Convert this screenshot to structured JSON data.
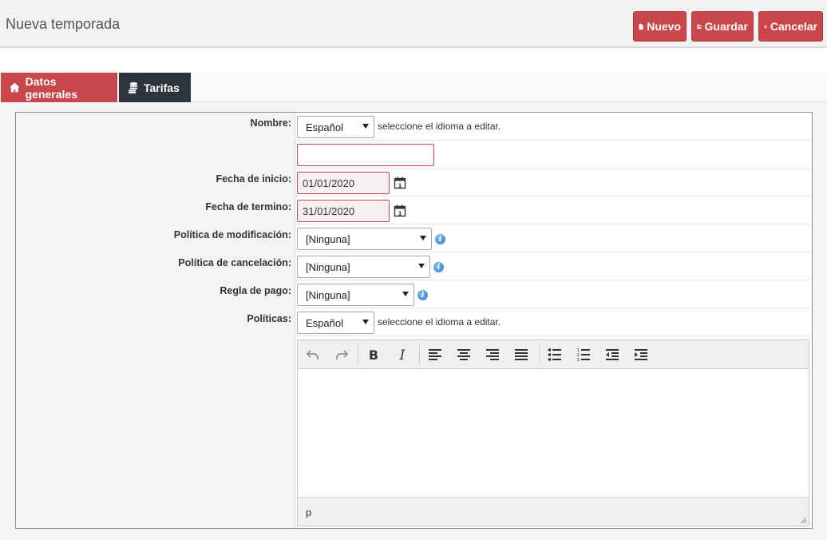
{
  "header": {
    "title": "Nueva temporada",
    "buttons": {
      "nuevo": "Nuevo",
      "guardar": "Guardar",
      "cancelar": "Cancelar"
    }
  },
  "tabs": [
    {
      "label": "Datos generales",
      "active": true
    },
    {
      "label": "Tarifas",
      "active": false
    }
  ],
  "form": {
    "nombre": {
      "label": "Nombre:",
      "language": "Español",
      "hint": "seleccione el idioma a editar.",
      "value": ""
    },
    "fecha_inicio": {
      "label": "Fecha de inicio:",
      "value": "01/01/2020"
    },
    "fecha_termino": {
      "label": "Fecha de termino:",
      "value": "31/01/2020"
    },
    "politica_modificacion": {
      "label": "Política de modificación:",
      "value": "[Ninguna]"
    },
    "politica_cancelacion": {
      "label": "Política de cancelación:",
      "value": "[Ninguna]"
    },
    "regla_pago": {
      "label": "Regla de pago:",
      "value": "[Ninguna]"
    },
    "politicas": {
      "label": "Políticas:",
      "language": "Español",
      "hint": "seleccione el idioma a editar."
    }
  },
  "editor": {
    "statusbar_path": "p"
  },
  "colors": {
    "accent": "#c9474a",
    "dark_tab": "#2d343c",
    "info": "#2f7fc7"
  }
}
